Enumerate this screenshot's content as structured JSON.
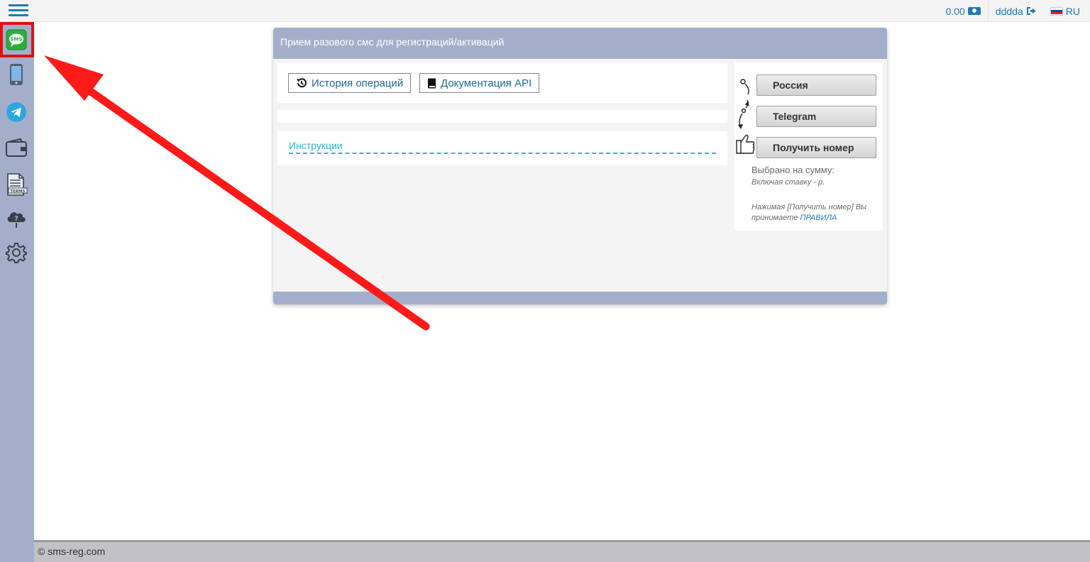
{
  "topbar": {
    "balance": "0.00",
    "username": "dddda",
    "language": "RU"
  },
  "sidebar": {
    "items": [
      {
        "name": "sms-icon",
        "label": "SMS"
      },
      {
        "name": "phone-icon"
      },
      {
        "name": "telegram-icon"
      },
      {
        "name": "wallet-icon"
      },
      {
        "name": "document-icon",
        "label": "TERMS"
      },
      {
        "name": "cloud-help-icon"
      },
      {
        "name": "gear-icon"
      }
    ]
  },
  "panel": {
    "title": "Прием разового смс для регистраций/активаций",
    "history_button": "История операций",
    "api_button": "Документация API",
    "instructions_link": "Инструкции"
  },
  "order": {
    "country_button": "Россия",
    "service_button": "Telegram",
    "get_number_button": "Получить номер",
    "selected_sum": "Выбрано на сумму:",
    "including_rate": "Включая ставку - р.",
    "agreement_text": "Нажимая [Получить номер] Вы принимаете",
    "rules_link": "ПРАВИЛА"
  },
  "footer": {
    "copyright": "© sms-reg.com"
  },
  "colors": {
    "accent": "#1f7bb0",
    "sidebar_bg": "#a3afca",
    "highlight": "#e01010",
    "link_cyan": "#20b8d8"
  }
}
